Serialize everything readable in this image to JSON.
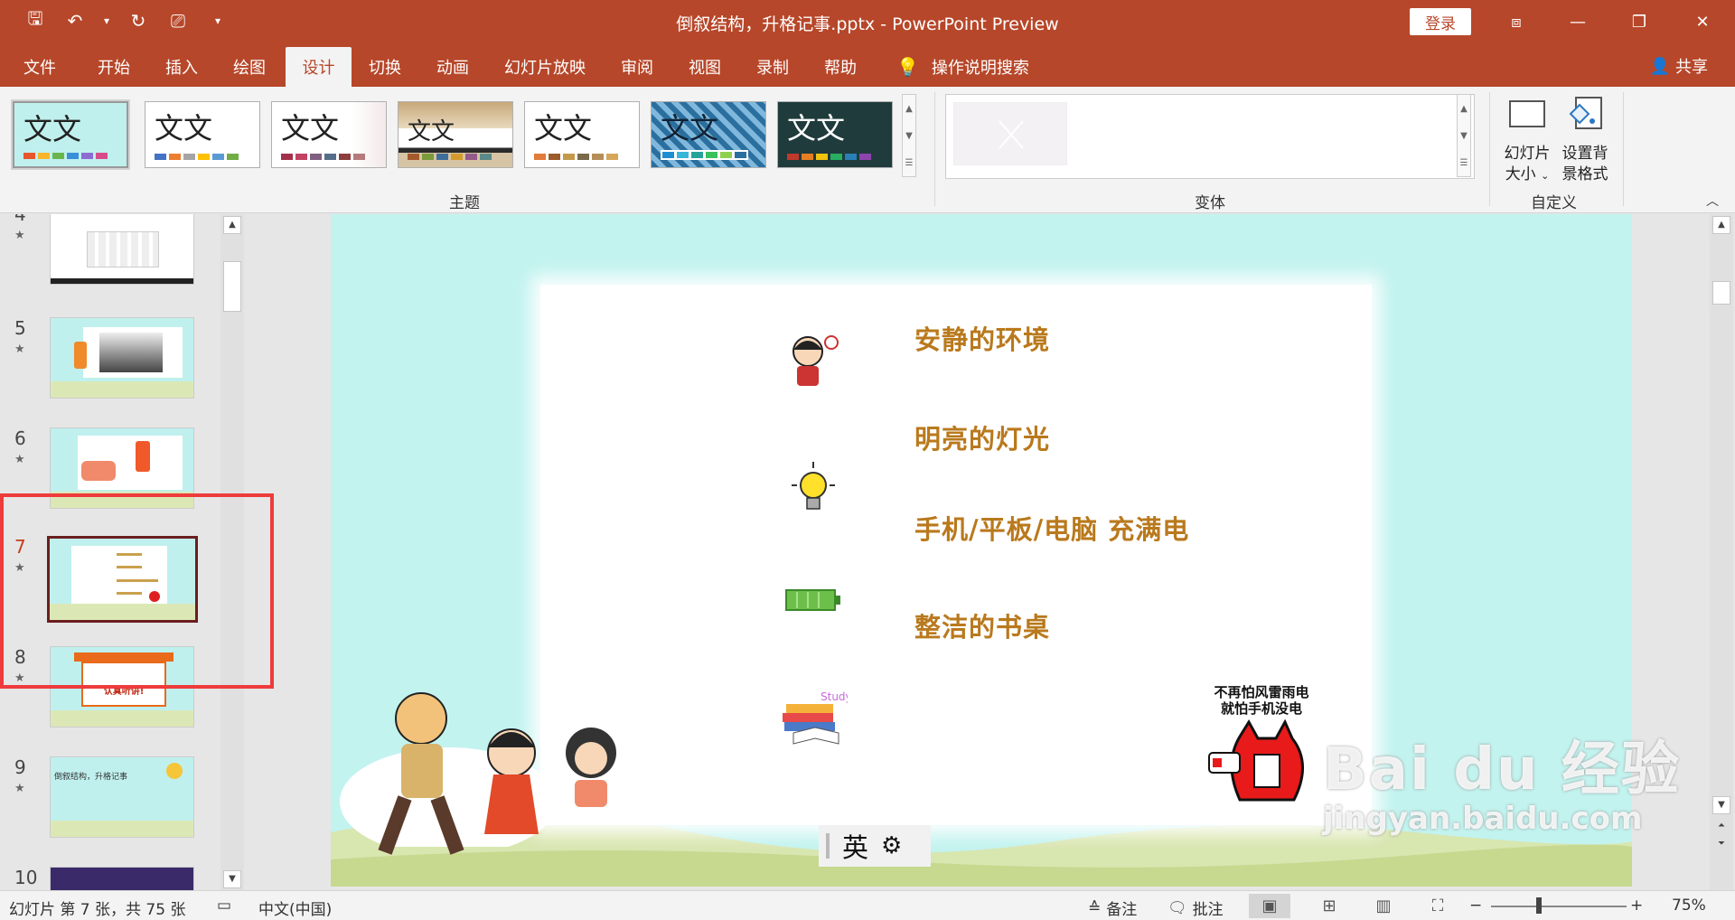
{
  "titlebar": {
    "title": "倒叙结构，升格记事.pptx  -  PowerPoint Preview",
    "login_label": "登录"
  },
  "tabs": [
    {
      "label": "文件"
    },
    {
      "label": "开始"
    },
    {
      "label": "插入"
    },
    {
      "label": "绘图"
    },
    {
      "label": "设计",
      "active": true
    },
    {
      "label": "切换"
    },
    {
      "label": "动画"
    },
    {
      "label": "幻灯片放映"
    },
    {
      "label": "审阅"
    },
    {
      "label": "视图"
    },
    {
      "label": "录制"
    },
    {
      "label": "帮助"
    },
    {
      "label": "操作说明搜索"
    }
  ],
  "share_label": "共享",
  "ribbon": {
    "theme_glyph": "文文",
    "themes_group_label": "主题",
    "variants_group_label": "变体",
    "customize_group_label": "自定义",
    "slide_size_label_1": "幻灯片",
    "slide_size_label_2": "大小",
    "format_bg_label_1": "设置背",
    "format_bg_label_2": "景格式"
  },
  "slides_pane": {
    "items": [
      {
        "num": "4"
      },
      {
        "num": "5"
      },
      {
        "num": "6"
      },
      {
        "num": "7",
        "current": true
      },
      {
        "num": "8"
      },
      {
        "num": "9"
      },
      {
        "num": "10"
      }
    ],
    "thumb8_title": "认真听讲!",
    "thumb9_title": "倒叙结构，升格记事"
  },
  "slide": {
    "rows": [
      {
        "text": "安静的环境"
      },
      {
        "text": "明亮的灯光"
      },
      {
        "text": "手机/平板/电脑  充满电"
      },
      {
        "text": "整洁的书桌"
      }
    ],
    "meme_line1": "不再怕风雷雨电",
    "meme_line2": "就怕手机没电",
    "study_label": "Study"
  },
  "ime": {
    "label": "英"
  },
  "watermark": {
    "big": "Bai du 经验",
    "small": "jingyan.baidu.com"
  },
  "statusbar": {
    "slide_info": "幻灯片 第 7 张，共 75 张",
    "language": "中文(中国)",
    "notes_label": "备注",
    "comments_label": "批注",
    "zoom": "75%"
  },
  "colors": {
    "accent": "#b7472a",
    "slide_text": "#b9791c",
    "highlight_frame": "#ee3b3b"
  }
}
